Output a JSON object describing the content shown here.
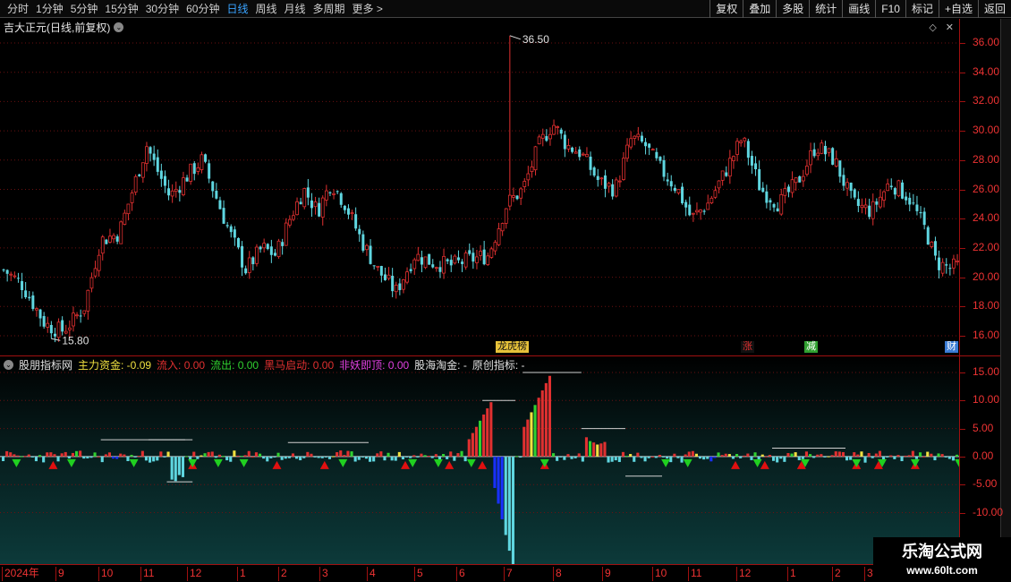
{
  "toolbar": {
    "timeframes": [
      "分时",
      "1分钟",
      "5分钟",
      "15分钟",
      "30分钟",
      "60分钟",
      "日线",
      "周线",
      "月线",
      "多周期",
      "更多 >"
    ],
    "active_timeframe": "日线",
    "tools": [
      "复权",
      "叠加",
      "多股",
      "统计",
      "画线",
      "F10",
      "标记",
      "+自选",
      "返回"
    ]
  },
  "price_pane": {
    "title": "吉大正元(日线,前复权)",
    "y_labels": [
      "36.00",
      "34.00",
      "32.00",
      "30.00",
      "28.00",
      "26.00",
      "24.00",
      "22.00",
      "20.00",
      "18.00",
      "16.00"
    ],
    "high_annotation": "36.50",
    "low_annotation": "15.80",
    "events": [
      {
        "text": "龙虎榜",
        "color": "#e7c23a"
      },
      {
        "text": "涨",
        "color": "#e03030"
      },
      {
        "text": "减",
        "color": "#30c030"
      },
      {
        "text": "财",
        "color": "#3a7bd5"
      }
    ]
  },
  "indicator_pane": {
    "name": "股朋指标网",
    "legend": [
      {
        "label": "主力资金: -0.09",
        "color": "#f0e040"
      },
      {
        "label": "流入: 0.00",
        "color": "#e03030"
      },
      {
        "label": "流出: 0.00",
        "color": "#30d030"
      },
      {
        "label": "黑马启动: 0.00",
        "color": "#e03030"
      },
      {
        "label": "非妖即顶: 0.00",
        "color": "#e040e0"
      },
      {
        "label": "股海淘金: -",
        "color": "#e0e0e0"
      },
      {
        "label": "原创指标: -",
        "color": "#e0e0e0"
      }
    ],
    "y_labels": [
      "15.00",
      "10.00",
      "5.00",
      "0.00",
      "-5.00",
      "-10.00"
    ]
  },
  "date_axis": {
    "labels": [
      "2024年",
      "9",
      "10",
      "11",
      "12",
      "1",
      "2",
      "3",
      "4",
      "5",
      "6",
      "7",
      "8",
      "9",
      "10",
      "11",
      "12",
      "1",
      "2",
      "3"
    ]
  },
  "watermark": {
    "title": "乐淘公式网",
    "url": "www.60lt.com"
  },
  "colors": {
    "up": "#e03030",
    "down": "#5fd6e0",
    "axis": "#e33",
    "grid": "#6a1010"
  }
}
